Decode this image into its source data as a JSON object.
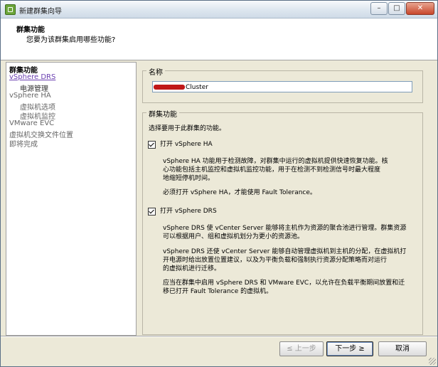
{
  "window": {
    "title": "新建群集向导"
  },
  "controls": {
    "minimize": "–",
    "maximize": "□",
    "close": "✕"
  },
  "header": {
    "title": "群集功能",
    "subtitle": "您要为该群集启用哪些功能?"
  },
  "nav": {
    "items": [
      {
        "label": "群集功能"
      },
      {
        "label": "vSphere DRS"
      },
      {
        "label": "电源管理"
      },
      {
        "label": "vSphere HA"
      },
      {
        "label": "虚拟机选项"
      },
      {
        "label": "虚拟机监控"
      },
      {
        "label": "VMware EVC"
      },
      {
        "label": "虚拟机交换文件位置"
      },
      {
        "label": "即将完成"
      }
    ]
  },
  "name_group": {
    "label": "名称",
    "value": "Cluster"
  },
  "features": {
    "label": "群集功能",
    "instruction": "选择要用于此群集的功能。",
    "ha": {
      "checkbox_label": "打开 vSphere HA",
      "desc_lines": [
        "vSphere HA 功能用于检测故障，对群集中运行的虚拟机提供快速恢复功能。核",
        "心功能包括主机监控和虚拟机监控功能，用于在检测不到检测信号时最大程度",
        "地缩短停机时间。"
      ],
      "note": "必须打开 vSphere HA，才能使用 Fault Tolerance。"
    },
    "drs": {
      "checkbox_label": "打开 vSphere DRS",
      "desc1_lines": [
        "vSphere DRS 使 vCenter Server 能够将主机作为资源的聚合池进行管理。群集资源",
        "可以根据用户、组和虚拟机划分为更小的资源池。"
      ],
      "desc2_lines": [
        "vSphere DRS 还使 vCenter Server 能够自动管理虚拟机到主机的分配，在虚拟机打",
        "开电源时给出放置位置建议，以及为平衡负载和强制执行资源分配策略而对运行",
        "的虚拟机进行迁移。"
      ],
      "desc3_lines": [
        "应当在群集中启用 vSphere DRS 和 VMware EVC，以允许在负载平衡期间放置和迁",
        "移已打开 Fault Tolerance 的虚拟机。"
      ]
    }
  },
  "buttons": {
    "back": "≤ 上一步",
    "next": "下一步 ≥",
    "cancel": "取消"
  }
}
